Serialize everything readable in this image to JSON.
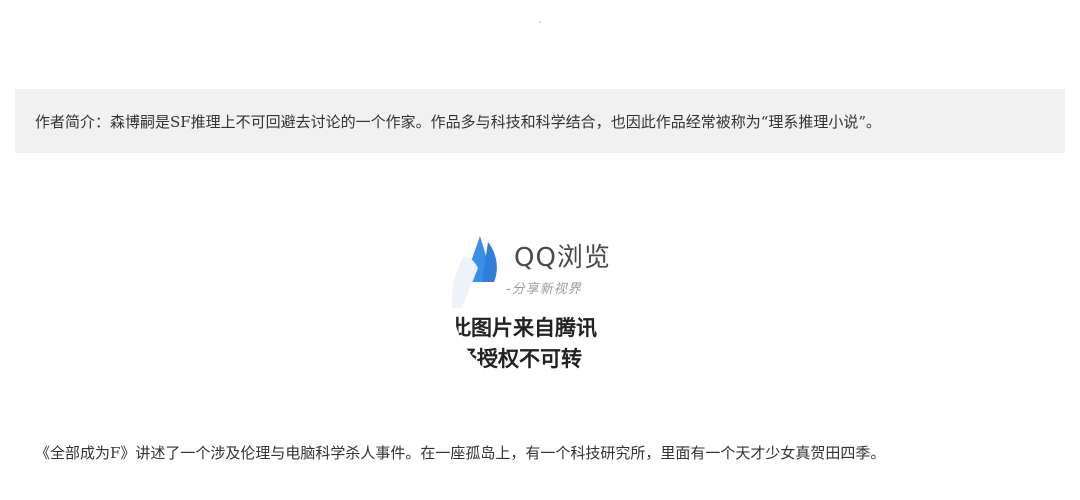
{
  "intro": {
    "text": "作者简介：森博嗣是SF推理上不可回避去讨论的一个作家。作品多与科技和科学结合，也因此作品经常被称为“理系推理小说”。"
  },
  "image": {
    "icon": "qq-browser-logo-icon",
    "watermark_brand": "QQ浏览",
    "watermark_slogan": "-分享新视界",
    "watermark_notice_line1": "此图片来自腾讯",
    "watermark_notice_line2": "经授权不可转"
  },
  "story": {
    "text": "《全部成为F》讲述了一个涉及伦理与电脑科学杀人事件。在一座孤岛上，有一个科技研究所，里面有一个天才少女真贺田四季。"
  },
  "colors": {
    "intro_background": "#f1f1f1",
    "text": "#333333",
    "logo_blue": "#3a8ee6"
  }
}
